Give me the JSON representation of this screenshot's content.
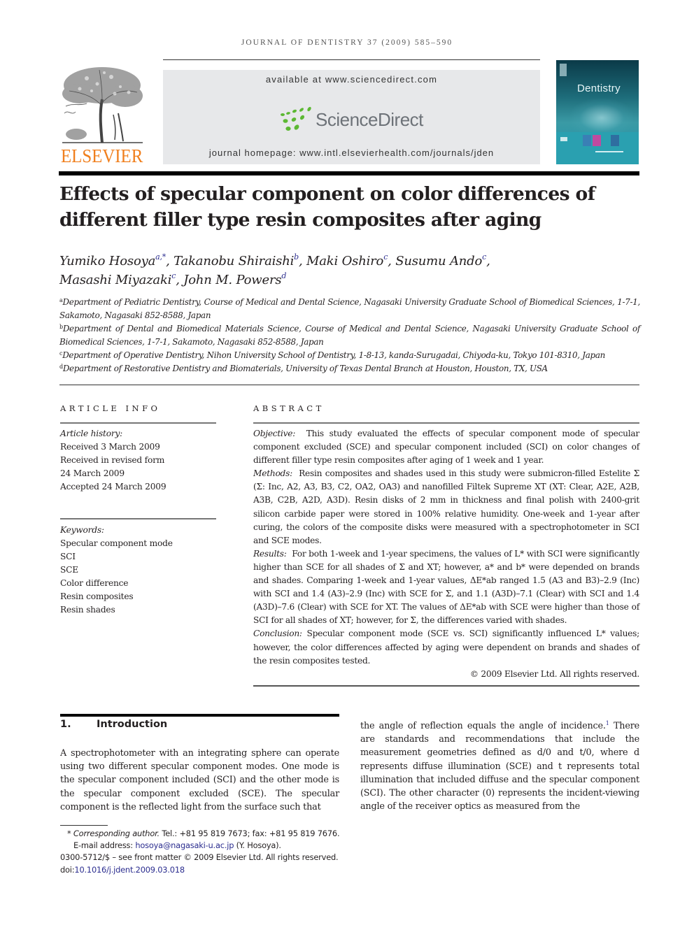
{
  "header": {
    "running_head": "JOURNAL OF DENTISTRY 37 (2009) 585–590",
    "publisher_logo_text": "ELSEVIER",
    "available_at": "available at www.sciencedirect.com",
    "sciencedirect_logo_text": "ScienceDirect",
    "journal_homepage": "journal homepage: www.intl.elsevierhealth.com/journals/jden",
    "cover_title": "Dentistry",
    "colors": {
      "elsevier_orange": "#f07f1d",
      "sciencedirect_green": "#5cb833",
      "sciencedirect_grey": "#6d7278",
      "banner_bg": "#e7e8ea",
      "cover_teal": "#2597a8",
      "link_blue": "#2b2d8f"
    }
  },
  "article": {
    "title": "Effects of specular component on color differences of different filler type resin composites after aging",
    "authors": [
      {
        "name": "Yumiko Hosoya",
        "sup": "a,*",
        "sep": ", "
      },
      {
        "name": "Takanobu Shiraishi",
        "sup": "b",
        "sep": ", "
      },
      {
        "name": "Maki Oshiro",
        "sup": "c",
        "sep": ", "
      },
      {
        "name": "Susumu Ando",
        "sup": "c",
        "sep": ","
      },
      {
        "name": "Masashi Miyazaki",
        "sup": "c",
        "sep": ", "
      },
      {
        "name": "John M. Powers",
        "sup": "d",
        "sep": ""
      }
    ],
    "affiliations": [
      {
        "key": "a",
        "text": "Department of Pediatric Dentistry, Course of Medical and Dental Science, Nagasaki University Graduate School of Biomedical Sciences, 1-7-1, Sakamoto, Nagasaki 852-8588, Japan"
      },
      {
        "key": "b",
        "text": "Department of Dental and Biomedical Materials Science, Course of Medical and Dental Science, Nagasaki University Graduate School of Biomedical Sciences, 1-7-1, Sakamoto, Nagasaki 852-8588, Japan"
      },
      {
        "key": "c",
        "text": "Department of Operative Dentistry, Nihon University School of Dentistry, 1-8-13, kanda-Surugadai, Chiyoda-ku, Tokyo 101-8310, Japan"
      },
      {
        "key": "d",
        "text": "Department of Restorative Dentistry and Biomaterials, University of Texas Dental Branch at Houston, Houston, TX, USA"
      }
    ]
  },
  "article_info": {
    "label": "ARTICLE INFO",
    "history_header": "Article history:",
    "history": [
      "Received 3 March 2009",
      "Received in revised form",
      "24 March 2009",
      "Accepted 24 March 2009"
    ],
    "keywords_header": "Keywords:",
    "keywords": [
      "Specular component mode",
      "SCI",
      "SCE",
      "Color difference",
      "Resin composites",
      "Resin shades"
    ]
  },
  "abstract": {
    "label": "ABSTRACT",
    "sections": [
      {
        "lead": "Objective:",
        "text": "This study evaluated the effects of specular component mode of specular component excluded (SCE) and specular component included (SCI) on color changes of different filler type resin composites after aging of 1 week and 1 year."
      },
      {
        "lead": "Methods:",
        "text": "Resin composites and shades used in this study were submicron-filled Estelite Σ (Σ: Inc, A2, A3, B3, C2, OA2, OA3) and nanofilled Filtek Supreme XT (XT: Clear, A2E, A2B, A3B, C2B, A2D, A3D). Resin disks of 2 mm in thickness and final polish with 2400-grit silicon carbide paper were stored in 100% relative humidity. One-week and 1-year after curing, the colors of the composite disks were measured with a spectrophotometer in SCI and SCE modes."
      },
      {
        "lead": "Results:",
        "text": "For both 1-week and 1-year specimens, the values of L* with SCI were significantly higher than SCE for all shades of Σ and XT; however, a* and b* were depended on brands and shades. Comparing 1-week and 1-year values, ΔE*ab ranged 1.5 (A3 and B3)–2.9 (Inc) with SCI and 1.4 (A3)–2.9 (Inc) with SCE for Σ, and 1.1 (A3D)–7.1 (Clear) with SCI and 1.4 (A3D)–7.6 (Clear) with SCE for XT. The values of ΔE*ab with SCE were higher than those of SCI for all shades of XT; however, for Σ, the differences varied with shades."
      },
      {
        "lead": "Conclusion:",
        "text": "Specular component mode (SCE vs. SCI) significantly influenced L* values; however, the color differences affected by aging were dependent on brands and shades of the resin composites tested."
      }
    ],
    "copyright": "© 2009 Elsevier Ltd. All rights reserved."
  },
  "introduction": {
    "number": "1.",
    "heading": "Introduction",
    "left_column": "A spectrophotometer with an integrating sphere can operate using two different specular component modes. One mode is the specular component included (SCI) and the other mode is the specular component excluded (SCE). The specular component is the reflected light from the surface such that",
    "right_column_before_ref": "the angle of reflection equals the angle of incidence.",
    "ref": "1",
    "right_column_after_ref": " There are standards and recommendations that include the measurement geometries defined as d/0 and t/0, where d represents diffuse illumination (SCE) and t represents total illumination that included diffuse and the specular component (SCI). The other character (0) represents the incident-viewing angle of the receiver optics as measured from the"
  },
  "footnotes": {
    "corresponding_marker": "*",
    "corresponding_label": "Corresponding author.",
    "contact": " Tel.: +81 95 819 7673; fax: +81 95 819 7676.",
    "email_label": "E-mail address: ",
    "email": "hosoya@nagasaki-u.ac.jp",
    "email_suffix": " (Y. Hosoya).",
    "issn_line": "0300-5712/$ – see front matter © 2009 Elsevier Ltd. All rights reserved.",
    "doi_label": "doi:",
    "doi": "10.1016/j.jdent.2009.03.018"
  }
}
